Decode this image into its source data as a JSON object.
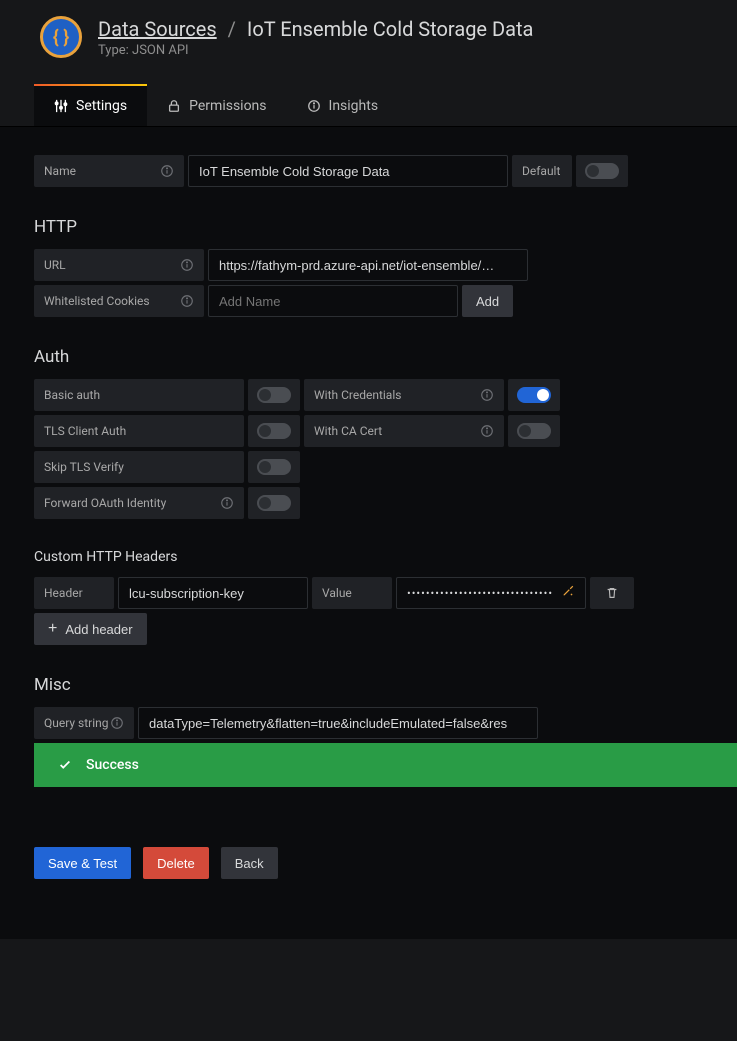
{
  "breadcrumb": {
    "root": "Data Sources",
    "current": "IoT Ensemble Cold Storage Data",
    "subtype": "Type: JSON API"
  },
  "tabs": {
    "settings": "Settings",
    "permissions": "Permissions",
    "insights": "Insights"
  },
  "form": {
    "name_label": "Name",
    "name_value": "IoT Ensemble Cold Storage Data",
    "default_label": "Default",
    "default_on": false
  },
  "http": {
    "title": "HTTP",
    "url_label": "URL",
    "url_value": "https://fathym-prd.azure-api.net/iot-ensemble/…",
    "cookies_label": "Whitelisted Cookies",
    "cookies_placeholder": "Add Name",
    "add_btn": "Add"
  },
  "auth": {
    "title": "Auth",
    "basic_label": "Basic auth",
    "basic_on": false,
    "cred_label": "With Credentials",
    "cred_on": true,
    "tls_label": "TLS Client Auth",
    "tls_on": false,
    "ca_label": "With CA Cert",
    "ca_on": false,
    "skip_label": "Skip TLS Verify",
    "skip_on": false,
    "oauth_label": "Forward OAuth Identity",
    "oauth_on": false
  },
  "headers": {
    "title": "Custom HTTP Headers",
    "header_label": "Header",
    "header_value": "lcu-subscription-key",
    "value_label": "Value",
    "value_masked": "•••••••••••••••••••••••••••••••",
    "add_btn": "Add header"
  },
  "misc": {
    "title": "Misc",
    "query_label": "Query string",
    "query_value": "dataType=Telemetry&flatten=true&includeEmulated=false&res"
  },
  "alert": {
    "text": "Success"
  },
  "buttons": {
    "save": "Save & Test",
    "delete": "Delete",
    "back": "Back"
  }
}
